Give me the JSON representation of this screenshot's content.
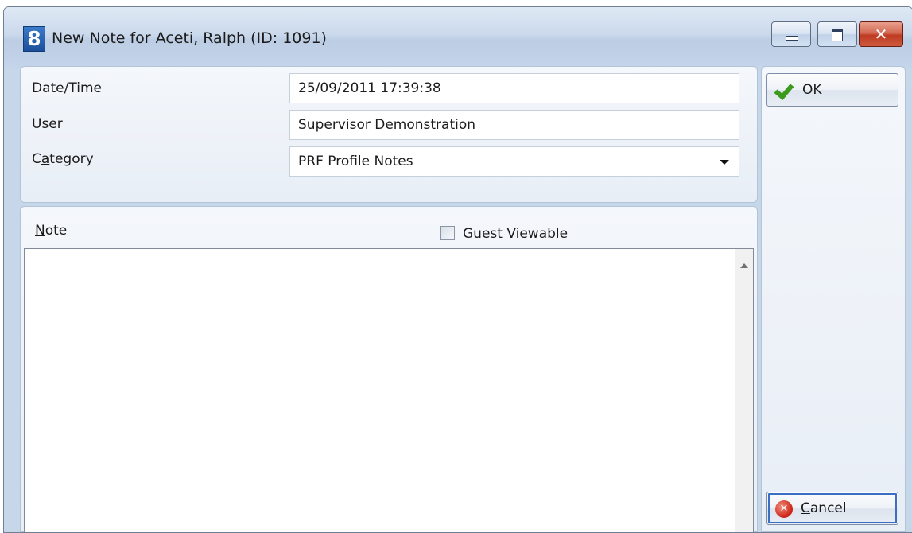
{
  "window": {
    "app_icon_glyph": "8",
    "title": "New Note for Aceti, Ralph (ID: 1091)",
    "close_glyph": "✕"
  },
  "form": {
    "datetime": {
      "label": "Date/Time",
      "value": "25/09/2011 17:39:38"
    },
    "user": {
      "label": "User",
      "value": "Supervisor Demonstration"
    },
    "category": {
      "label_pre": "C",
      "label_u": "a",
      "label_post": "tegory",
      "value": "PRF Profile Notes"
    }
  },
  "note": {
    "label_u": "N",
    "label_post": "ote",
    "guest_viewable": {
      "label_pre": "Guest ",
      "label_u": "V",
      "label_post": "iewable",
      "checked": false
    },
    "content": ""
  },
  "buttons": {
    "ok": {
      "label_u": "O",
      "label_post": "K"
    },
    "cancel": {
      "label_u": "C",
      "label_post": "ancel",
      "icon_glyph": "✕"
    }
  },
  "colors": {
    "accent": "#3a6fc4",
    "ok_icon": "#3d9a1c",
    "cancel_icon": "#cc2414"
  }
}
